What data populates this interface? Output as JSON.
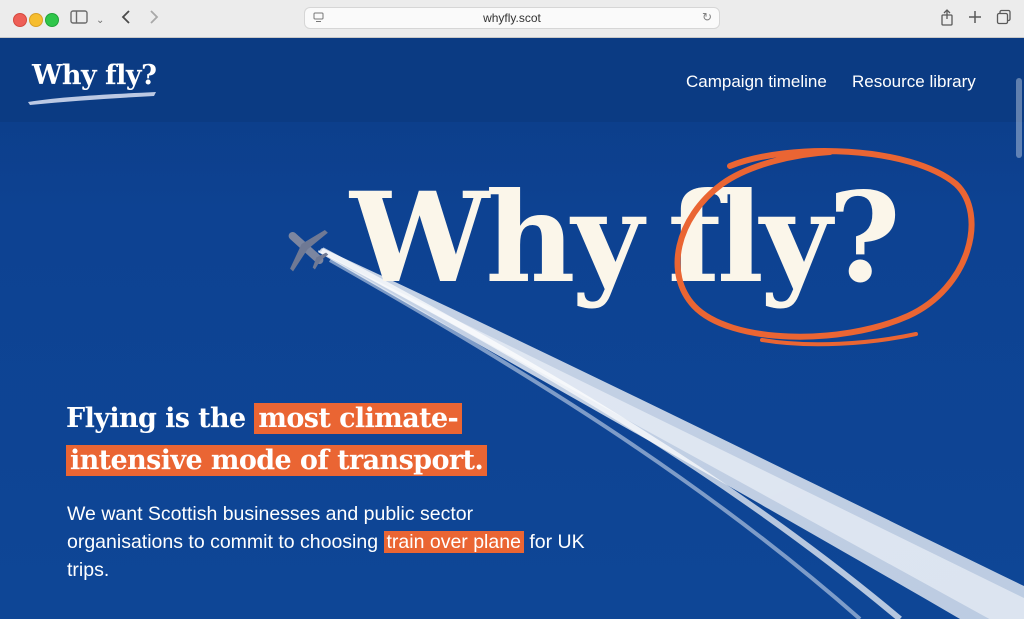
{
  "browser": {
    "url": "whyfly.scot"
  },
  "site": {
    "logo": "Why fly?",
    "nav": [
      "Campaign timeline",
      "Resource library"
    ]
  },
  "hero": {
    "title_word1": "Why",
    "title_word2": "fly?",
    "headline_pre": "Flying is the ",
    "headline_highlight": "most climate-intensive mode of transport.",
    "body_pre": "We want Scottish businesses and public sector organisations to commit to choosing ",
    "body_highlight": "train over plane",
    "body_post": " for UK trips."
  },
  "colors": {
    "background": "#0d4191",
    "accent": "#ea6533",
    "title": "#fbf6ea"
  }
}
